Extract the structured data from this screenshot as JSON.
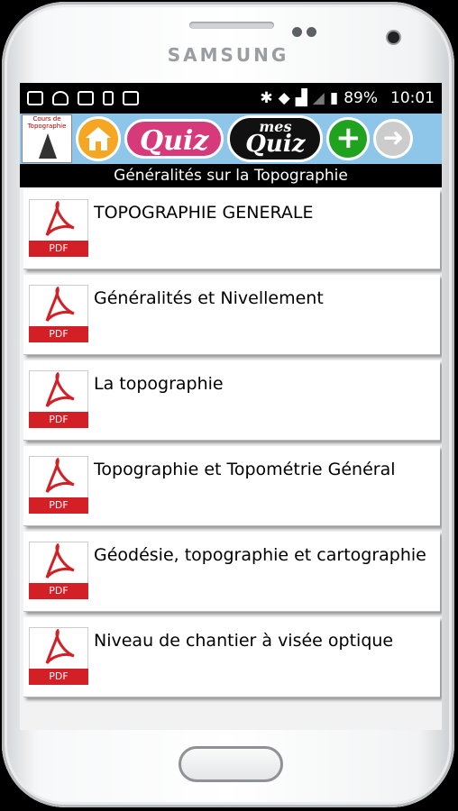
{
  "device": {
    "brand": "SAMSUNG"
  },
  "status_bar": {
    "battery": "89%",
    "time": "10:01"
  },
  "toolbar": {
    "logo_text": "Cours de Topographie",
    "quiz_label": "Quiz",
    "mes_quiz_top": "mes",
    "mes_quiz_bottom": "Quiz",
    "add_label": "+",
    "forward_label": "➜"
  },
  "page_title": "Généralités sur la Topographie",
  "items": [
    {
      "label": "TOPOGRAPHIE GENERALE",
      "badge": "PDF"
    },
    {
      "label": "Généralités et Nivellement",
      "badge": "PDF"
    },
    {
      "label": "La topographie",
      "badge": "PDF"
    },
    {
      "label": "Topographie et Topométrie Général",
      "badge": "PDF"
    },
    {
      "label": "Géodésie, topographie et cartographie",
      "badge": "PDF"
    },
    {
      "label": "Niveau de chantier à visée optique",
      "badge": "PDF"
    }
  ]
}
